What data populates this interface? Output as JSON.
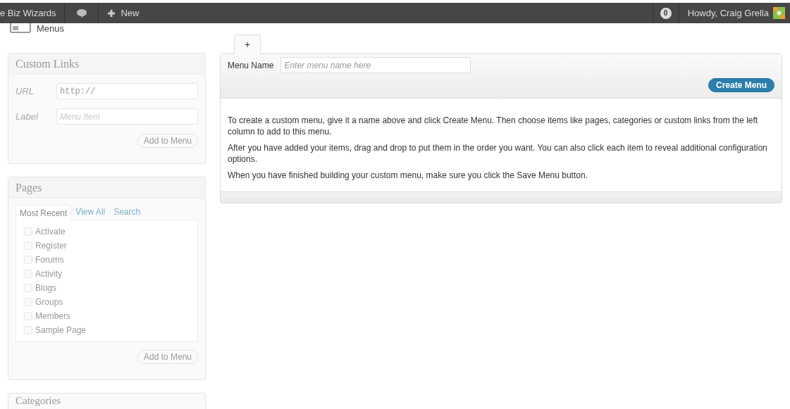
{
  "admin_bar": {
    "site_name": "e Biz Wizards",
    "new_label": "New",
    "notification_count": "0",
    "greeting": "Howdy, Craig Grella"
  },
  "page_title": "Menus",
  "custom_links": {
    "title": "Custom Links",
    "url_label": "URL",
    "url_value": "http://",
    "label_label": "Label",
    "label_placeholder": "Menu Item",
    "button": "Add to Menu"
  },
  "pages": {
    "title": "Pages",
    "tabs": [
      {
        "label": "Most Recent",
        "selected": true
      },
      {
        "label": "View All",
        "selected": false
      },
      {
        "label": "Search",
        "selected": false
      }
    ],
    "items": [
      {
        "label": "Activate",
        "checked": false
      },
      {
        "label": "Register",
        "checked": false
      },
      {
        "label": "Forums",
        "checked": false
      },
      {
        "label": "Activity",
        "checked": false
      },
      {
        "label": "Blogs",
        "checked": false
      },
      {
        "label": "Groups",
        "checked": false
      },
      {
        "label": "Members",
        "checked": false
      },
      {
        "label": "Sample Page",
        "checked": false
      }
    ],
    "button": "Add to Menu"
  },
  "categories": {
    "title": "Categories"
  },
  "menu_tabs": [
    {
      "label": "+",
      "selected": true
    }
  ],
  "menu_editor": {
    "name_label": "Menu Name",
    "name_placeholder": "Enter menu name here",
    "create_button": "Create Menu",
    "paragraphs": [
      "To create a custom menu, give it a name above and click Create Menu. Then choose items like pages, categories or custom links from the left column to add to this menu.",
      "After you have added your items, drag and drop to put them in the order you want. You can also click each item to reveal additional configuration options.",
      "When you have finished building your custom menu, make sure you click the Save Menu button."
    ]
  }
}
